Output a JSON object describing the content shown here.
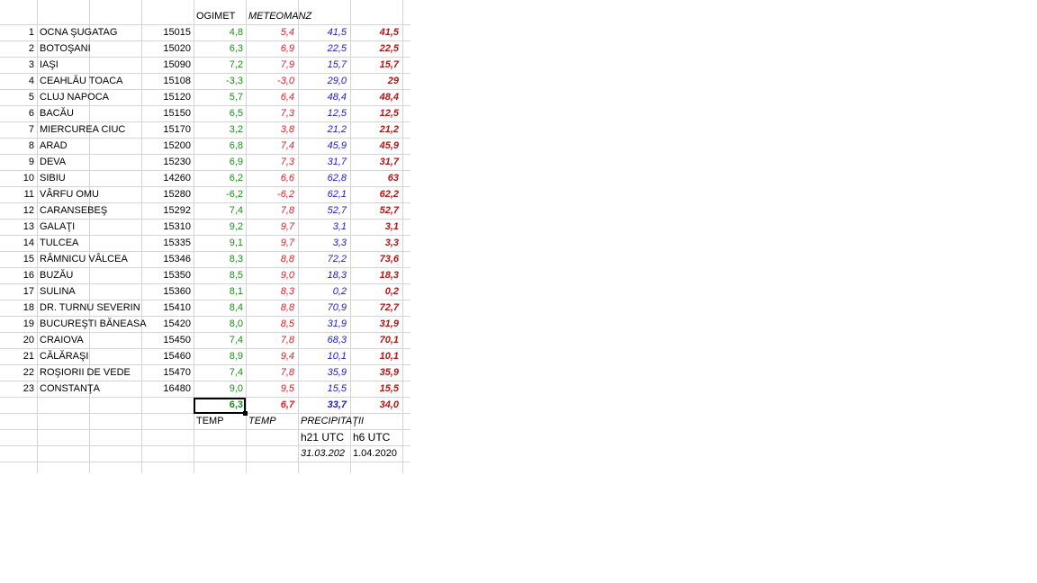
{
  "headers": {
    "ogimet": "OGIMET",
    "meteomanz": "METEOMANZ"
  },
  "rows": [
    {
      "n": "1",
      "name": "OCNA ŞUGATAG",
      "station": "15015",
      "ogimet": "4,8",
      "meteomanz": "5,4",
      "precip": "41,5",
      "precip_h6": "41,5"
    },
    {
      "n": "2",
      "name": "BOTOŞANI",
      "station": "15020",
      "ogimet": "6,3",
      "meteomanz": "6,9",
      "precip": "22,5",
      "precip_h6": "22,5"
    },
    {
      "n": "3",
      "name": "IAŞI",
      "station": "15090",
      "ogimet": "7,2",
      "meteomanz": "7,9",
      "precip": "15,7",
      "precip_h6": "15,7"
    },
    {
      "n": "4",
      "name": "CEAHLĂU TOACA",
      "station": "15108",
      "ogimet": "-3,3",
      "meteomanz": "-3,0",
      "precip": "29,0",
      "precip_h6": "29"
    },
    {
      "n": "5",
      "name": "CLUJ NAPOCA",
      "station": "15120",
      "ogimet": "5,7",
      "meteomanz": "6,4",
      "precip": "48,4",
      "precip_h6": "48,4"
    },
    {
      "n": "6",
      "name": "BACĂU",
      "station": "15150",
      "ogimet": "6,5",
      "meteomanz": "7,3",
      "precip": "12,5",
      "precip_h6": "12,5"
    },
    {
      "n": "7",
      "name": "MIERCUREA CIUC",
      "station": "15170",
      "ogimet": "3,2",
      "meteomanz": "3,8",
      "precip": "21,2",
      "precip_h6": "21,2"
    },
    {
      "n": "8",
      "name": "ARAD",
      "station": "15200",
      "ogimet": "6,8",
      "meteomanz": "7,4",
      "precip": "45,9",
      "precip_h6": "45,9"
    },
    {
      "n": "9",
      "name": "DEVA",
      "station": "15230",
      "ogimet": "6,9",
      "meteomanz": "7,3",
      "precip": "31,7",
      "precip_h6": "31,7"
    },
    {
      "n": "10",
      "name": "SIBIU",
      "station": "14260",
      "ogimet": "6,2",
      "meteomanz": "6,6",
      "precip": "62,8",
      "precip_h6": "63"
    },
    {
      "n": "11",
      "name": "VÂRFU OMU",
      "station": "15280",
      "ogimet": "-6,2",
      "meteomanz": "-6,2",
      "precip": "62,1",
      "precip_h6": "62,2"
    },
    {
      "n": "12",
      "name": "CARANSEBEŞ",
      "station": "15292",
      "ogimet": "7,4",
      "meteomanz": "7,8",
      "precip": "52,7",
      "precip_h6": "52,7"
    },
    {
      "n": "13",
      "name": "GALAŢI",
      "station": "15310",
      "ogimet": "9,2",
      "meteomanz": "9,7",
      "precip": "3,1",
      "precip_h6": "3,1"
    },
    {
      "n": "14",
      "name": "TULCEA",
      "station": "15335",
      "ogimet": "9,1",
      "meteomanz": "9,7",
      "precip": "3,3",
      "precip_h6": "3,3"
    },
    {
      "n": "15",
      "name": "RÂMNICU VÂLCEA",
      "station": "15346",
      "ogimet": "8,3",
      "meteomanz": "8,8",
      "precip": "72,2",
      "precip_h6": "73,6"
    },
    {
      "n": "16",
      "name": "BUZĂU",
      "station": "15350",
      "ogimet": "8,5",
      "meteomanz": "9,0",
      "precip": "18,3",
      "precip_h6": "18,3"
    },
    {
      "n": "17",
      "name": "SULINA",
      "station": "15360",
      "ogimet": "8,1",
      "meteomanz": "8,3",
      "precip": "0,2",
      "precip_h6": "0,2"
    },
    {
      "n": "18",
      "name": "DR. TURNU SEVERIN",
      "station": "15410",
      "ogimet": "8,4",
      "meteomanz": "8,8",
      "precip": "70,9",
      "precip_h6": "72,7"
    },
    {
      "n": "19",
      "name": "BUCUREŞTI BĂNEASA",
      "station": "15420",
      "ogimet": "8,0",
      "meteomanz": "8,5",
      "precip": "31,9",
      "precip_h6": "31,9"
    },
    {
      "n": "20",
      "name": "CRAIOVA",
      "station": "15450",
      "ogimet": "7,4",
      "meteomanz": "7,8",
      "precip": "68,3",
      "precip_h6": "70,1"
    },
    {
      "n": "21",
      "name": "CĂLĂRAŞI",
      "station": "15460",
      "ogimet": "8,9",
      "meteomanz": "9,4",
      "precip": "10,1",
      "precip_h6": "10,1"
    },
    {
      "n": "22",
      "name": "ROŞIORII DE VEDE",
      "station": "15470",
      "ogimet": "7,4",
      "meteomanz": "7,8",
      "precip": "35,9",
      "precip_h6": "35,9"
    },
    {
      "n": "23",
      "name": "CONSTANŢA",
      "station": "16480",
      "ogimet": "9,0",
      "meteomanz": "9,5",
      "precip": "15,5",
      "precip_h6": "15,5"
    }
  ],
  "averages": {
    "ogimet": "6,3",
    "meteomanz": "6,7",
    "precip": "33,7",
    "precip_h6": "34,0"
  },
  "footer": {
    "temp_ogimet": "TEMP",
    "temp_meteomanz": "TEMP",
    "precip_label": "PRECIPITAŢII",
    "h21": "h21 UTC",
    "h6": "h6 UTC",
    "date1": "31.03.202",
    "date2": "1.04.2020"
  }
}
